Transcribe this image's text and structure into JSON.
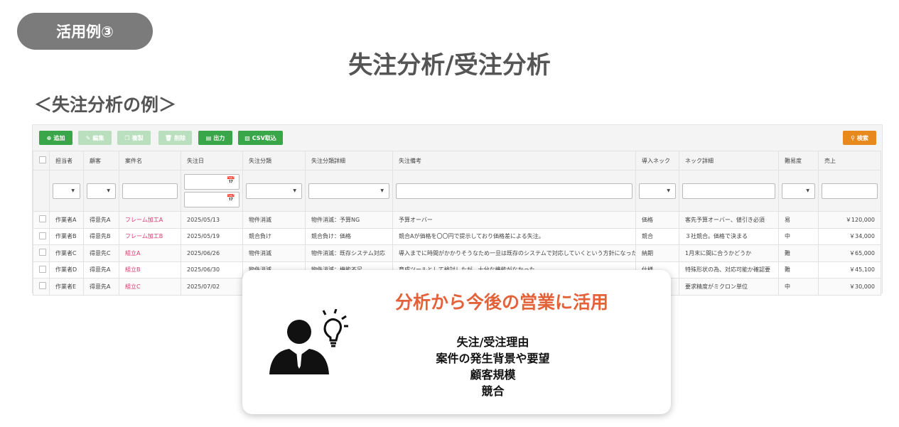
{
  "badge": "活用例③",
  "title": "失注分析/受注分析",
  "subtitle": "＜失注分析の例＞",
  "toolbar": {
    "add": "追加",
    "edit": "編集",
    "copy": "複製",
    "delete": "削除",
    "export": "出力",
    "csv_import": "CSV取込",
    "search": "検索"
  },
  "columns": [
    "担当者",
    "顧客",
    "案件名",
    "失注日",
    "失注分類",
    "失注分類詳細",
    "失注備考",
    "導入ネック",
    "ネック詳細",
    "難易度",
    "売上"
  ],
  "rows": [
    [
      "作業者A",
      "得意先A",
      "フレーム加工A",
      "2025/05/13",
      "物件消滅",
      "物件消滅：予算NG",
      "予算オーバー",
      "価格",
      "客先予算オーバー、値引き必須",
      "易",
      "￥120,000"
    ],
    [
      "作業者B",
      "得意先B",
      "フレーム加工B",
      "2025/05/19",
      "競合負け",
      "競合負け：価格",
      "競合Aが価格を〇〇円で提示しており価格差による失注。",
      "競合",
      "３社競合。価格で決まる",
      "中",
      "￥34,000"
    ],
    [
      "作業者C",
      "得意先C",
      "組立A",
      "2025/06/26",
      "物件消滅",
      "物件消滅：既存システム対応",
      "導入までに時間がかかりそうなため一旦は既存のシステムで対応していくという方針になった",
      "納期",
      "1月末に間に合うかどうか",
      "難",
      "￥65,000"
    ],
    [
      "作業者D",
      "得意先A",
      "組立B",
      "2025/06/30",
      "物件消滅",
      "物件消滅：機能不足",
      "育成ツールとして検討したが、十分な機能がなかった",
      "仕様",
      "特殊形状の為、対応可能か確認要",
      "難",
      "￥45,100"
    ],
    [
      "作業者E",
      "得意先A",
      "組立C",
      "2025/07/02",
      "",
      "",
      "",
      "",
      "要求精度がミクロン単位",
      "中",
      "￥30,000"
    ]
  ],
  "card": {
    "title": "分析から今後の営業に活用",
    "lines": [
      "失注/受注理由",
      "案件の発生背景や要望",
      "顧客規模",
      "競合"
    ]
  },
  "colors": {
    "accent": "#e4623a",
    "green": "#3aa64a",
    "orange": "#e8891e",
    "link": "#d9386b"
  }
}
